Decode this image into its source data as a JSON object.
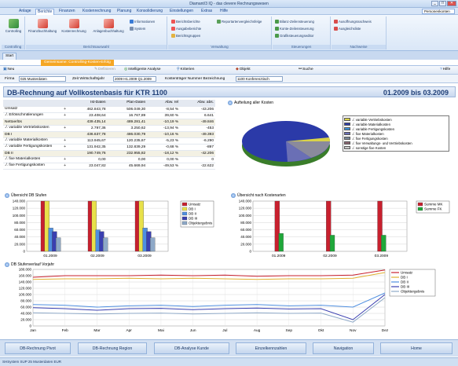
{
  "window": {
    "title": "Diamant/3 IQ - das clevere Rechnungswesen"
  },
  "menu": {
    "tabs": [
      "Anlage",
      "Berichte",
      "Finanzen",
      "Kostenrechnung",
      "Planung",
      "Konsolidierung",
      "Einstellungen",
      "Extras",
      "Hilfe"
    ],
    "active_index": 1,
    "search_value": "Personenkonten"
  },
  "ribbon": {
    "controlling_label": "Controlling",
    "controlling_group": "Controlling",
    "berichte_buttons": [
      "Finanzbuchhaltung",
      "Kostenrechnung",
      "Anlagenbuchhaltung",
      "Informationen",
      "System"
    ],
    "berichte_group": "Berichtsauswahl",
    "verwaltung_buttons": [
      "Berichtsberichte",
      "Ausgabeberichte",
      "Berichtsgruppen",
      "Reportartenvergleichsfelge"
    ],
    "verwaltung_group": "Verwaltung",
    "steuerungen_buttons": [
      "Bilanz-Zeilensteuerung",
      "Konte-Zeilensteuerung",
      "Grafiksteuerungseditor"
    ],
    "steuerungen_group": "Steuerungen",
    "nachweise_buttons": [
      "Ausoffnungsnachweis",
      "Ausgleichsliste"
    ],
    "nachweise_group": "Nachweise"
  },
  "doc_tabs": {
    "start": "Start"
  },
  "subtab": {
    "label": "Gemeinsame: Controlling-Kosten-Erfolg"
  },
  "toolbar": {
    "new": "Neu",
    "definieren": "Definieren",
    "analyse": "Intelligente Analyse",
    "kriterien": "Kriterien",
    "objekt": "Objekt",
    "suche": "Suche",
    "hilfe": "Hilfe"
  },
  "filter": {
    "firma_label": "Firma",
    "firma_value": "025 Musterdaten",
    "zeit_label": "Zeit Wirtschaftsjahr",
    "zeit_value": "2009 H1.2009 Q1.2009",
    "ktr_label": "Kostenträger Nummer Bezeichnung",
    "ktr_value": "1100 Konferenztisch"
  },
  "report": {
    "title": "DB-Rechnung auf Vollkostenbasis für KTR 1100",
    "period": "01.2009 bis 03.2009"
  },
  "table": {
    "headers": [
      "",
      "Ist-Daten",
      "Plan-Daten",
      "Abw. rel",
      "Abw. abs."
    ],
    "rows": [
      {
        "label": "Umsatz",
        "ist": "462.843,78",
        "plan": "506.049,30",
        "rel": "-8,54 %",
        "abs": "-43.206",
        "plus": true
      },
      {
        "label": "./. Erlösschmälerungen",
        "ist": "23.408,64",
        "plan": "16.767,89",
        "rel": "39,60 %",
        "abs": "6.641",
        "plus": true
      },
      {
        "label": "Nettoerlös",
        "ist": "439.435,14",
        "plan": "489.281,41",
        "rel": "-10,19 %",
        "abs": "-49.846",
        "plus": false
      },
      {
        "label": "./. variable Vertriebskosten",
        "ist": "2.797,36",
        "plan": "3.250,62",
        "rel": "-13,94 %",
        "abs": "-453",
        "plus": true
      },
      {
        "label": "DB I",
        "ist": "436.637,78",
        "plan": "486.030,79",
        "rel": "-10,16 %",
        "abs": "-49.393",
        "plus": false
      },
      {
        "label": "./. variable Materialkosten",
        "ist": "113.945,67",
        "plan": "120.235,67",
        "rel": "-5,23 %",
        "abs": "-6.290",
        "plus": true
      },
      {
        "label": "./. variable Fertigungskosten",
        "ist": "131.942,35",
        "plan": "132.839,29",
        "rel": "-0,68 %",
        "abs": "-897",
        "plus": true
      },
      {
        "label": "DB II",
        "ist": "190.749,76",
        "plan": "232.955,82",
        "rel": "-18,12 %",
        "abs": "-42.206",
        "plus": false
      },
      {
        "label": "./. fixe Materialkosten",
        "ist": "0,00",
        "plan": "0,00",
        "rel": "0,00 %",
        "abs": "0",
        "plus": true
      },
      {
        "label": "./. fixe Fertigungskosten",
        "ist": "23.047,82",
        "plan": "45.669,94",
        "rel": "-49,53 %",
        "abs": "-22.622",
        "plus": true
      }
    ]
  },
  "pie": {
    "title": "Aufteilung aller Kosten",
    "legend": [
      "./. variable Vertriebskosten",
      "./. variable Materialkosten",
      "./. variable Fertigungskosten",
      "./. fixe Materialkosten",
      "./. fixe Fertigungskosten",
      "./. fixe Verwaltungs- und Vertriebskosten",
      "./. sonstige fixe Kosten"
    ],
    "colors": [
      "#d9d24a",
      "#2b3aa8",
      "#3a8fd6",
      "#6a6fb5",
      "#7b8a9c",
      "#8a6570",
      "#c9c9c9"
    ]
  },
  "chart_data": [
    {
      "type": "bar",
      "title": "Übersicht DB Stufen",
      "categories": [
        "01.2009",
        "02.2009",
        "03.2009"
      ],
      "ylim": [
        0,
        140000
      ],
      "series": [
        {
          "name": "Umsatz",
          "color": "#c8202e",
          "values": [
            160000,
            155000,
            150000
          ]
        },
        {
          "name": "DB I",
          "color": "#e8e14a",
          "values": [
            150000,
            145000,
            140000
          ]
        },
        {
          "name": "DB II",
          "color": "#4f8fe0",
          "values": [
            65000,
            60000,
            65000
          ]
        },
        {
          "name": "DB III",
          "color": "#3a3fb0",
          "values": [
            55000,
            55000,
            55000
          ]
        },
        {
          "name": "Objektergebnis",
          "color": "#8ea9c8",
          "values": [
            38000,
            38000,
            38000
          ]
        }
      ]
    },
    {
      "type": "bar",
      "title": "Übersicht nach Kostenarten",
      "categories": [
        "01.2009",
        "02.2009",
        "03.2009"
      ],
      "ylim": [
        0,
        140000
      ],
      "series": [
        {
          "name": "Summe MK",
          "color": "#c8202e",
          "values": [
            150000,
            140000,
            140000
          ]
        },
        {
          "name": "Summe FK",
          "color": "#1fa83a",
          "values": [
            50000,
            45000,
            45000
          ]
        }
      ]
    },
    {
      "type": "line",
      "title": "DB Stufenverlauf Vorjahr",
      "categories": [
        "Jan",
        "Feb",
        "Mar",
        "Apr",
        "Mai",
        "Jun",
        "Jul",
        "Aug",
        "Sep",
        "Okt",
        "Nov",
        "Dez"
      ],
      "ylim": [
        0,
        180000
      ],
      "series": [
        {
          "name": "Umsatz",
          "color": "#c8202e",
          "values": [
            155000,
            160000,
            160000,
            160000,
            162000,
            160000,
            162000,
            158000,
            160000,
            160000,
            162000,
            178000
          ]
        },
        {
          "name": "DB I",
          "color": "#e0b030",
          "values": [
            148000,
            150000,
            150000,
            152000,
            150000,
            152000,
            150000,
            148000,
            150000,
            150000,
            152000,
            170000
          ]
        },
        {
          "name": "DB II",
          "color": "#4f8fe0",
          "values": [
            68000,
            66000,
            60000,
            64000,
            66000,
            62000,
            66000,
            68000,
            64000,
            66000,
            60000,
            105000
          ]
        },
        {
          "name": "DB III",
          "color": "#3a3fb0",
          "values": [
            58000,
            55000,
            50000,
            55000,
            56000,
            52000,
            55000,
            57000,
            54000,
            55000,
            20000,
            100000
          ]
        },
        {
          "name": "Objektergebnis",
          "color": "#8ea9c8",
          "values": [
            42000,
            40000,
            38000,
            40000,
            41000,
            38000,
            40000,
            42000,
            40000,
            41000,
            12000,
            90000
          ]
        }
      ]
    }
  ],
  "nav": {
    "buttons": [
      "DB-Rechnung Pivot",
      "DB-Rechnung Region",
      "DB-Analyse Kunde",
      "Einzelkennzahlen",
      "Navigation",
      "Home"
    ]
  },
  "status": {
    "text": "SHSystem  SUP  25 Musterdaten  EUR"
  }
}
